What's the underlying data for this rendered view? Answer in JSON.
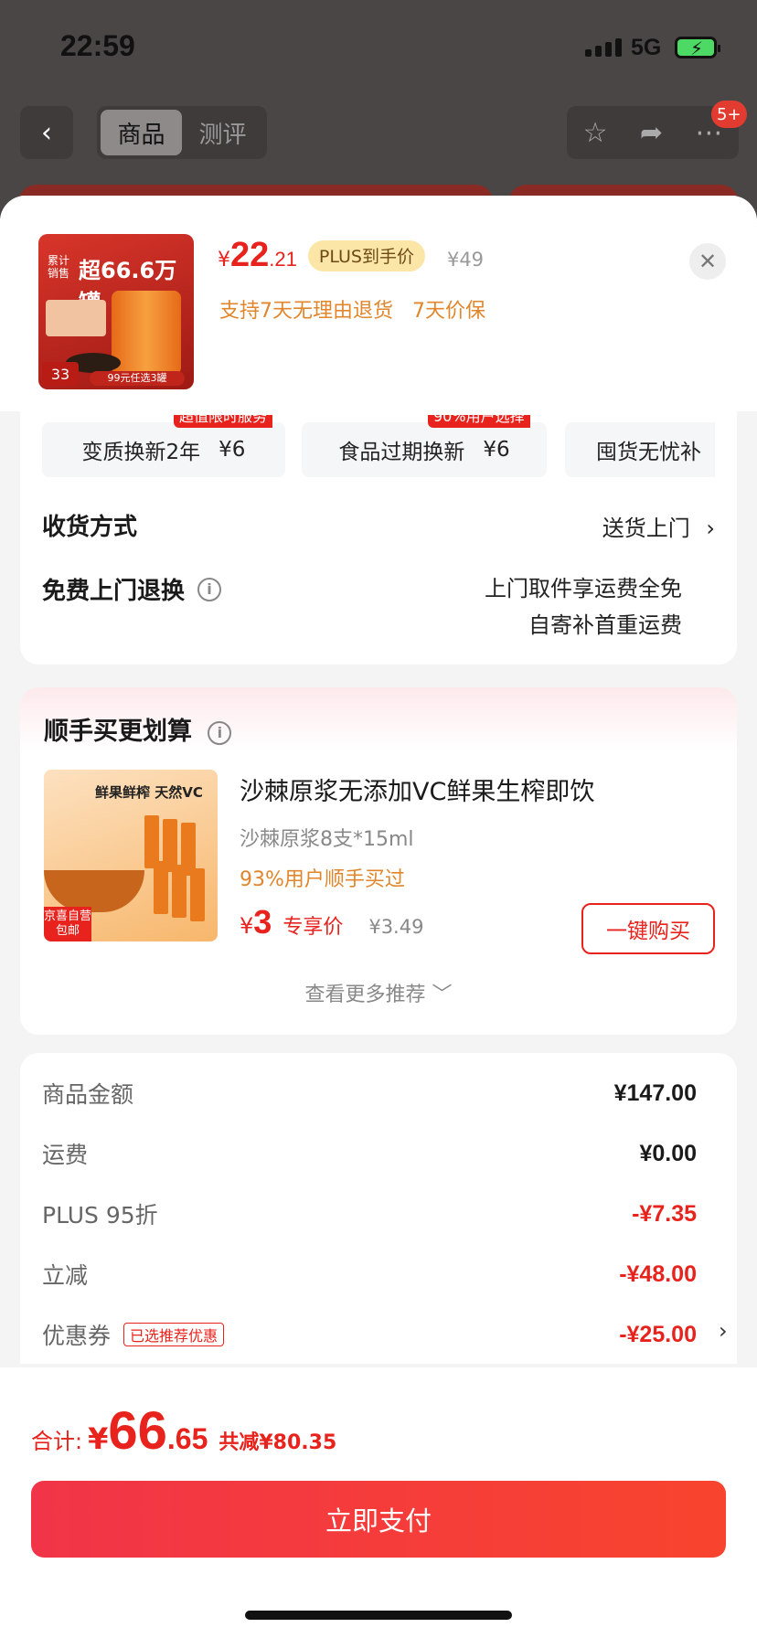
{
  "status_bar": {
    "time": "22:59",
    "network": "5G"
  },
  "nav": {
    "tabs": [
      "商品",
      "测评"
    ],
    "active_tab": "商品",
    "badge": "5+"
  },
  "product": {
    "currency": "¥",
    "price_int": "22",
    "price_dec": ".21",
    "plus_label": "PLUS到手价",
    "original_price": "¥49",
    "policies": "支持7天无理由退货   7天价保",
    "image_text": {
      "side": "累计销售",
      "sold": "超66.6万罐",
      "num": "33",
      "promo": "99元任选3罐"
    }
  },
  "services": [
    {
      "name": "变质换新2年",
      "price": "¥6",
      "tag": "超值限时服务"
    },
    {
      "name": "食品过期换新",
      "price": "¥6",
      "tag": "90%用户选择"
    },
    {
      "name": "囤货无忧补",
      "price": "",
      "tag": ""
    }
  ],
  "delivery": {
    "label": "收货方式",
    "value": "送货上门",
    "chevron": "›"
  },
  "free_return": {
    "label": "免费上门退换",
    "info": "i",
    "line1": "上门取件享运费全免",
    "line2": "自寄补首重运费"
  },
  "recommend": {
    "title": "顺手买更划算",
    "info": "i",
    "image_text": {
      "headline": "鲜果鲜榨  天然VC",
      "badge_top": "京喜自营",
      "badge_bottom": "包邮"
    },
    "item_name": "沙棘原浆无添加VC鲜果生榨即饮",
    "spec": "沙棘原浆8支*15ml",
    "bought": "93%用户顺手买过",
    "currency": "¥",
    "price": "3",
    "price_label": "专享价",
    "orig_price": "¥3.49",
    "buy_label": "一键购买",
    "more_label": "查看更多推荐 ﹀"
  },
  "summary": [
    {
      "label": "商品金额",
      "value": "¥147.00",
      "red": false
    },
    {
      "label": "运费",
      "value": "¥0.00",
      "red": false
    },
    {
      "label": "PLUS 95折",
      "value": "-¥7.35",
      "red": true
    },
    {
      "label": "立减",
      "value": "-¥48.00",
      "red": true
    },
    {
      "label": "优惠券",
      "value": "-¥25.00",
      "red": true,
      "tag": "已选推荐优惠"
    }
  ],
  "footer": {
    "total_label": "合计:",
    "currency": "¥",
    "total_int": "66",
    "total_dec": ".65",
    "saving": "共减¥80.35",
    "pay_label": "立即支付"
  },
  "colors": {
    "accent": "#e8221c",
    "orange": "#e0862c",
    "plus_tag": "#fbe6a8"
  }
}
